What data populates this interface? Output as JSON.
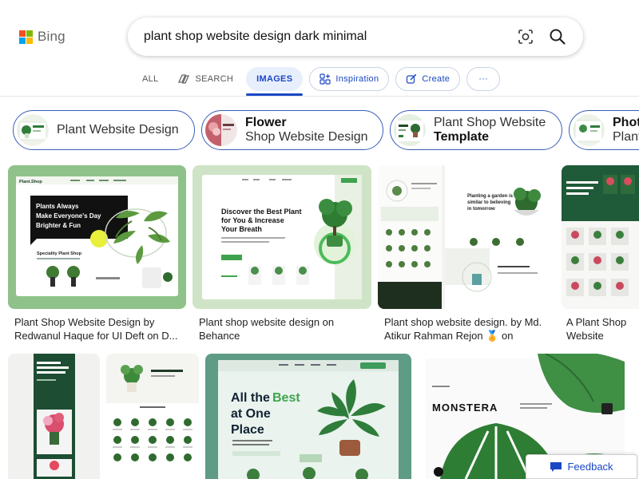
{
  "logo": {
    "text": "Bing"
  },
  "search": {
    "query": "plant shop website design dark minimal"
  },
  "tabs": [
    {
      "label": "ALL"
    },
    {
      "label": "SEARCH"
    },
    {
      "label": "IMAGES"
    },
    {
      "label": "Inspiration"
    },
    {
      "label": "Create"
    },
    {
      "label": "···"
    }
  ],
  "related": [
    {
      "line1": "Plant Website Design",
      "line2": ""
    },
    {
      "line1_bold": "Flower",
      "line2": "Shop Website Design"
    },
    {
      "line1": "Plant Shop Website",
      "line2_bold": "Template"
    },
    {
      "line1_bold": "Phot",
      "line2": "Plant"
    }
  ],
  "results_row1": [
    {
      "caption": "Plant Shop Website Design by Redwanul Haque for UI Deft on D...",
      "thumb": {
        "brand": "Plant.Shop",
        "headline": [
          "Plants Always",
          "Make Everyone's Day",
          "Brighter & Fun"
        ],
        "sub": "Speciality Plant Shop"
      }
    },
    {
      "caption": "Plant shop website design on Behance",
      "thumb": {
        "headline": [
          "Discover the Best Plant",
          "for You & Increase",
          "Your Breath"
        ]
      }
    },
    {
      "caption": "Plant shop website design. by Md. Atikur Rahman Rejon 🏅 on",
      "thumb": {
        "headline": [
          "Planting a garden is",
          "similar to believing",
          "in tomorrow"
        ]
      }
    },
    {
      "caption": "A Plant Shop Website Desig...",
      "thumb": {}
    }
  ],
  "results_row2": [
    {
      "thumb": {}
    },
    {
      "thumb": {}
    },
    {
      "thumb": {
        "headline": [
          "All the ",
          "Best",
          "at One",
          "Place"
        ]
      }
    },
    {
      "thumb": {
        "headline": [
          "MONSTERA"
        ]
      }
    }
  ],
  "feedback": {
    "label": "Feedback"
  },
  "colors": {
    "brand_blue": "#1a47c4",
    "chip_border": "#3a5fb8",
    "tab_active_bg": "#e8effc"
  }
}
